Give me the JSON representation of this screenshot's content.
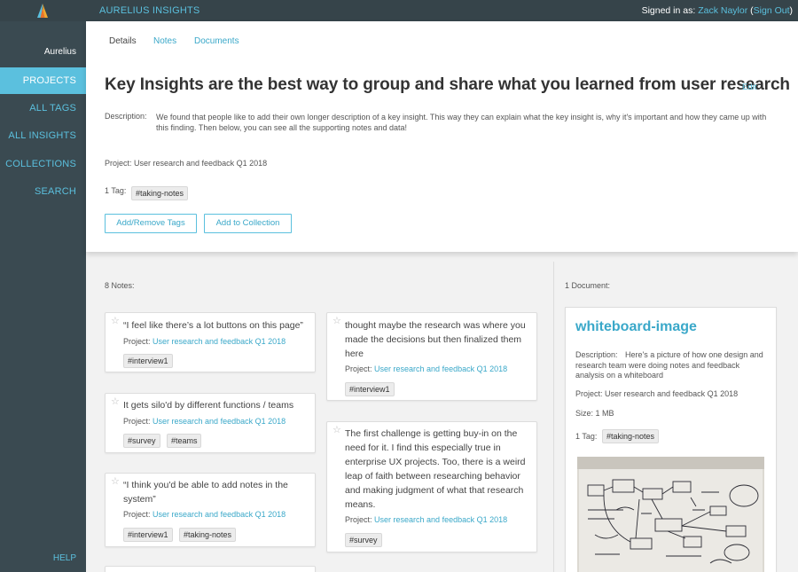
{
  "app": {
    "name": "AURELIUS INSIGHTS",
    "signed_in_prefix": "Signed in as:",
    "user_name": "Zack Naylor",
    "sign_out": "Sign Out",
    "brand": "Aurelius",
    "brand_color": "#5bc0de"
  },
  "sidebar": {
    "items": [
      {
        "label": "PROJECTS",
        "active": true
      },
      {
        "label": "ALL TAGS"
      },
      {
        "label": "ALL INSIGHTS"
      },
      {
        "label": "COLLECTIONS"
      },
      {
        "label": "SEARCH"
      }
    ],
    "help": "HELP"
  },
  "tabs": [
    {
      "label": "Details",
      "active": true
    },
    {
      "label": "Notes"
    },
    {
      "label": "Documents"
    }
  ],
  "insight": {
    "title": "Key Insights are the best way to group and share what you learned from user research",
    "edit": "Edit",
    "description_label": "Description:",
    "description": "We found that people like to add their own longer description of a key insight. This way they can explain what the key insight is, why it's important and how they came up with this finding. Then below, you can see all the supporting notes and data!",
    "project_line": "Project: User research and feedback Q1 2018",
    "tags_label": "1 Tag:",
    "tag": "#taking-notes",
    "add_remove_tags": "Add/Remove Tags",
    "add_to_collection": "Add to Collection"
  },
  "notes": {
    "count_label": "8 Notes:",
    "project_prefix": "Project:",
    "project_name": "User research and feedback Q1 2018",
    "items": [
      {
        "text": "“I feel like there’s a lot buttons on this page”",
        "tags": [
          "#interview1"
        ]
      },
      {
        "text": "thought maybe the research was where you made the decisions but then finalized them here",
        "tags": [
          "#interview1"
        ]
      },
      {
        "text": "It gets silo'd by different functions / teams",
        "tags": [
          "#survey",
          "#teams"
        ]
      },
      {
        "text": "The first challenge is getting buy-in on the need for it. I find this especially true in enterprise UX projects. Too, there is a weird leap of faith between researching behavior and making judgment of what that research means.",
        "tags": [
          "#survey"
        ]
      },
      {
        "text": "“I think you'd be able to add notes in the system”",
        "tags": [
          "#interview1",
          "#taking-notes"
        ]
      }
    ]
  },
  "documents": {
    "count_label": "1 Document:",
    "items": [
      {
        "title": "whiteboard-image",
        "description_label": "Description:",
        "description": "Here's a picture of how one design and research team were doing notes and feedback analysis on a whiteboard",
        "project_line": "Project: User research and feedback Q1 2018",
        "size": "Size: 1 MB",
        "tags_label": "1 Tag:",
        "tag": "#taking-notes"
      }
    ]
  }
}
